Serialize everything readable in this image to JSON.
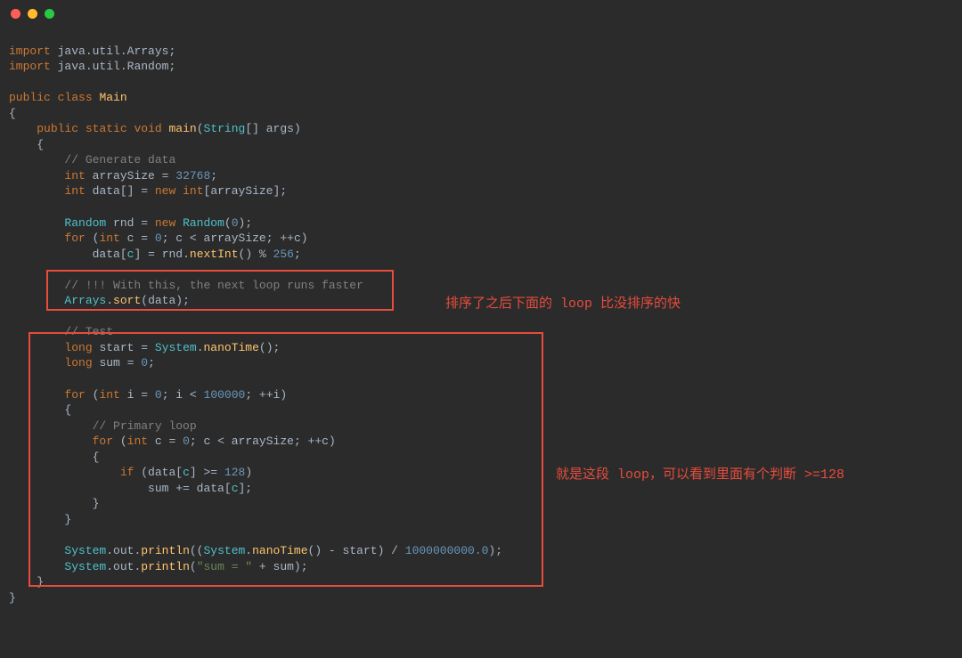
{
  "annotations": {
    "annotation1": "排序了之后下面的 loop 比没排序的快",
    "annotation2": "就是这段 loop，可以看到里面有个判断 >=128"
  },
  "code": {
    "line1_import": "import",
    "line1_pkg": "java.util.Arrays",
    "line2_import": "import",
    "line2_pkg": "java.util.Random",
    "line4_public": "public",
    "line4_class": "class",
    "line4_main": "Main",
    "line6_public": "public",
    "line6_static": "static",
    "line6_void": "void",
    "line6_main": "main",
    "line6_string": "String",
    "line6_args": "[] args",
    "line8_comment": "// Generate data",
    "line9_int": "int",
    "line9_var": "arraySize",
    "line9_val": "32768",
    "line10_int": "int",
    "line10_data": "data",
    "line10_new": "new",
    "line10_int2": "int",
    "line10_as": "arraySize",
    "line12_random": "Random",
    "line12_rnd": "rnd",
    "line12_new": "new",
    "line12_random2": "Random",
    "line12_zero": "0",
    "line13_for": "for",
    "line13_int": "int",
    "line13_c": "c",
    "line13_zero": "0",
    "line13_c2": "c",
    "line13_as": "arraySize",
    "line13_c3": "c",
    "line14_data": "data",
    "line14_c": "c",
    "line14_rnd": "rnd",
    "line14_nextint": "nextInt",
    "line14_256": "256",
    "line16_comment": "// !!! With this, the next loop runs faster",
    "line17_arrays": "Arrays",
    "line17_sort": "sort",
    "line17_data": "data",
    "line19_comment": "// Test",
    "line20_long": "long",
    "line20_start": "start",
    "line20_system": "System",
    "line20_nanotime": "nanoTime",
    "line21_long": "long",
    "line21_sum": "sum",
    "line21_zero": "0",
    "line23_for": "for",
    "line23_int": "int",
    "line23_i": "i",
    "line23_zero": "0",
    "line23_i2": "i",
    "line23_100000": "100000",
    "line23_i3": "i",
    "line25_comment": "// Primary loop",
    "line26_for": "for",
    "line26_int": "int",
    "line26_c": "c",
    "line26_zero": "0",
    "line26_c2": "c",
    "line26_as": "arraySize",
    "line26_c3": "c",
    "line28_if": "if",
    "line28_data": "data",
    "line28_c": "c",
    "line28_128": "128",
    "line29_sum": "sum",
    "line29_data": "data",
    "line29_c": "c",
    "line33_system": "System",
    "line33_out": "out",
    "line33_println": "println",
    "line33_system2": "System",
    "line33_nanotime": "nanoTime",
    "line33_start": "start",
    "line33_div": "1000000000.0",
    "line34_system": "System",
    "line34_out": "out",
    "line34_println": "println",
    "line34_str": "\"sum = \"",
    "line34_sum": "sum"
  }
}
